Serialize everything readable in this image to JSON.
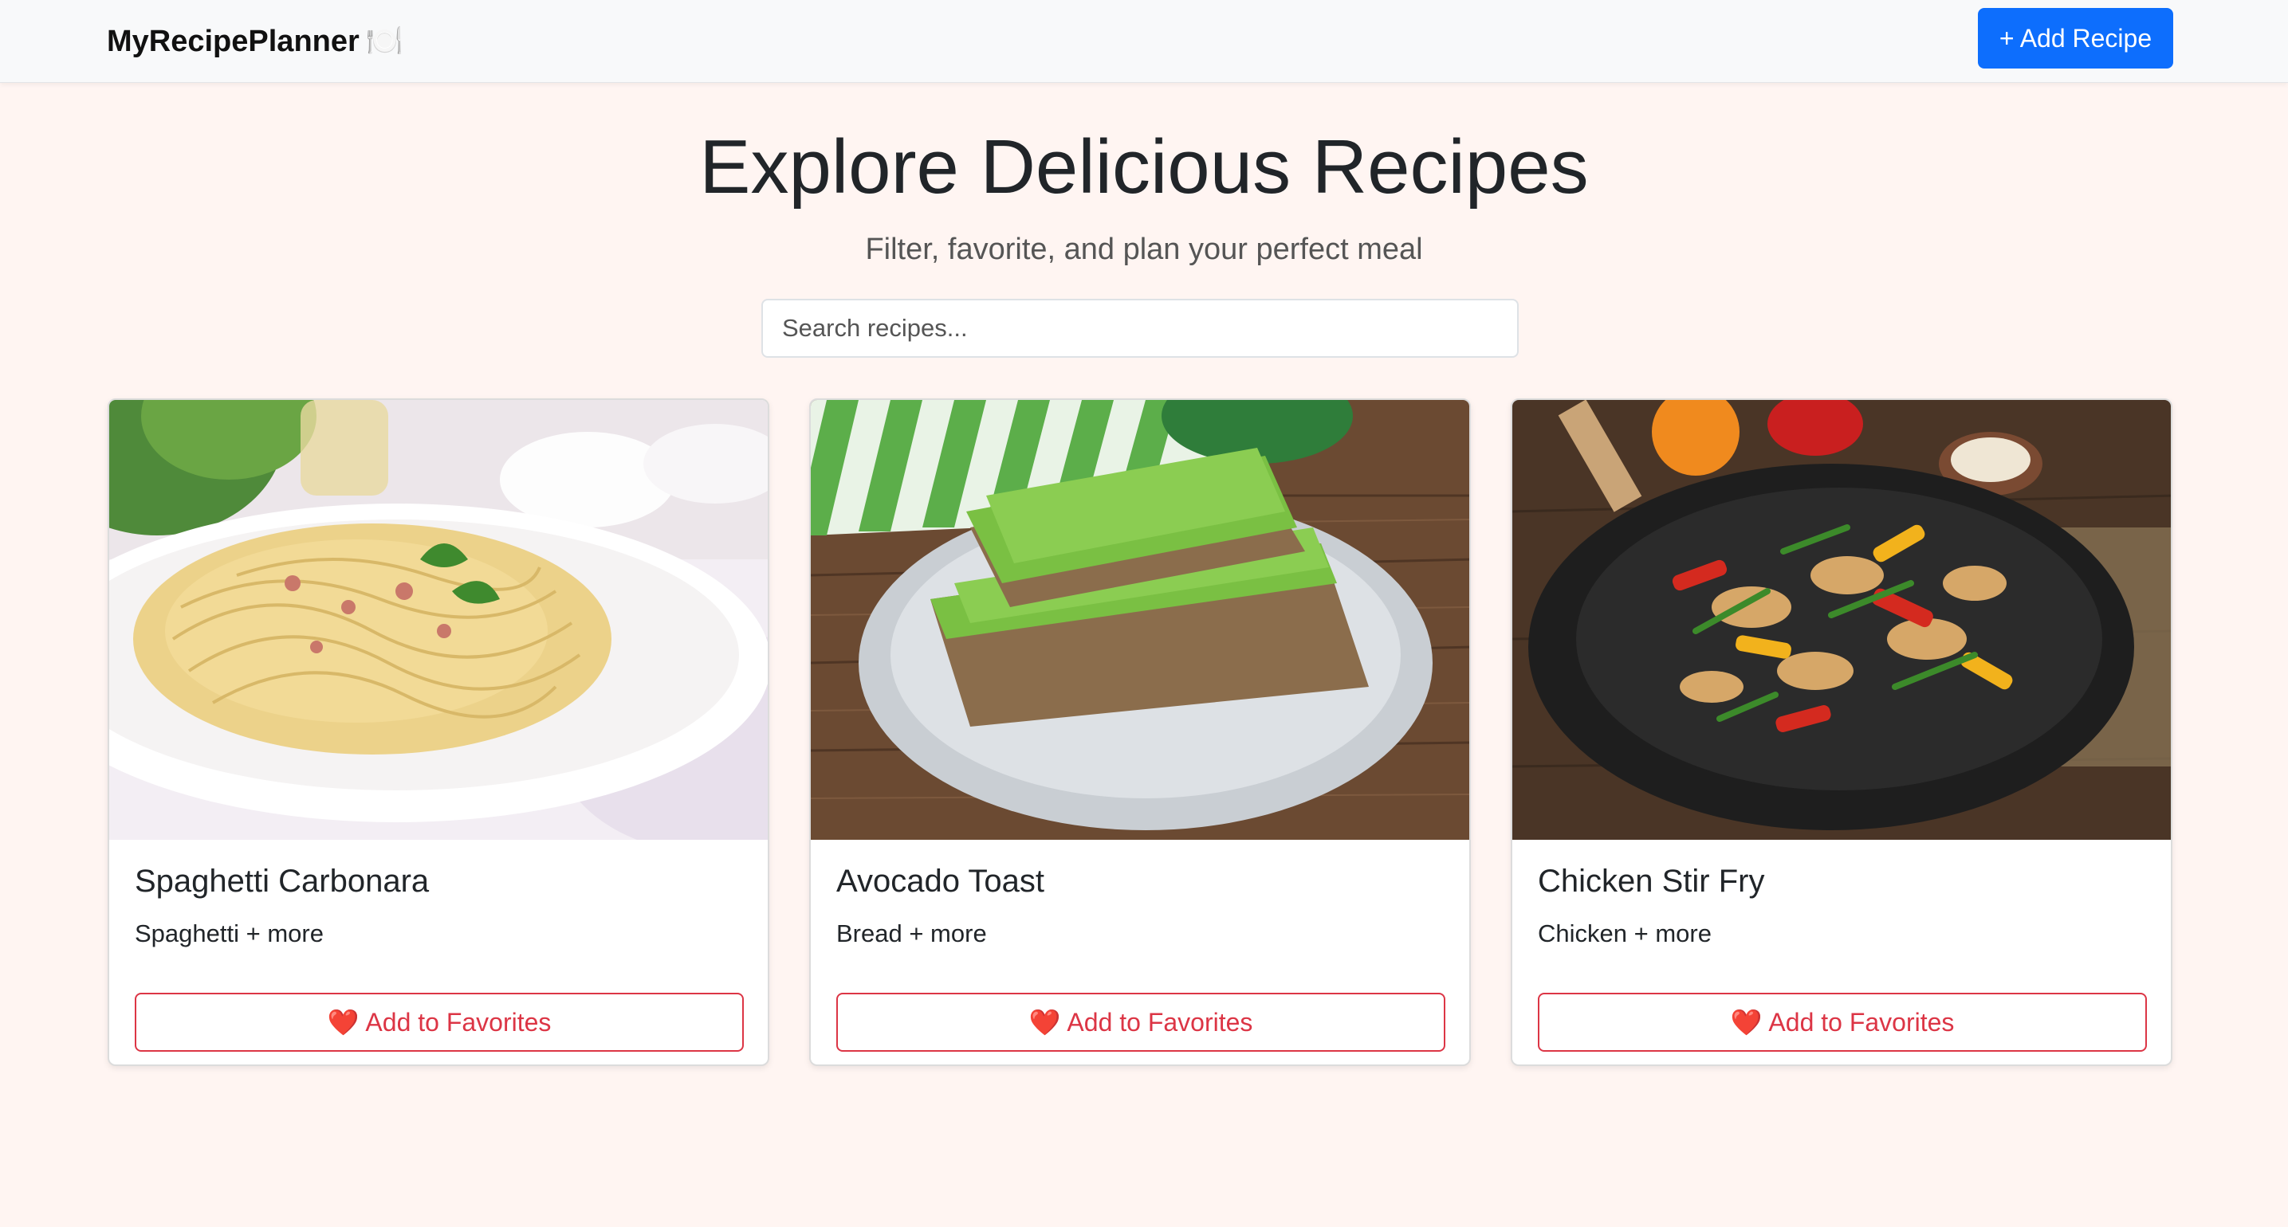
{
  "navbar": {
    "brand": "MyRecipePlanner",
    "brand_icon": "🍽️",
    "add_recipe_label": "+ Add Recipe"
  },
  "hero": {
    "title": "Explore Delicious Recipes",
    "subtitle": "Filter, favorite, and plan your perfect meal"
  },
  "search": {
    "placeholder": "Search recipes..."
  },
  "recipes": [
    {
      "title": "Spaghetti Carbonara",
      "subtitle": "Spaghetti + more",
      "favorite_label": "Add to Favorites",
      "image": "spaghetti-carbonara-photo"
    },
    {
      "title": "Avocado Toast",
      "subtitle": "Bread + more",
      "favorite_label": "Add to Favorites",
      "image": "avocado-toast-photo"
    },
    {
      "title": "Chicken Stir Fry",
      "subtitle": "Chicken + more",
      "favorite_label": "Add to Favorites",
      "image": "chicken-stir-fry-photo"
    }
  ],
  "icons": {
    "heart": "❤️"
  },
  "colors": {
    "primary": "#0d6efd",
    "danger": "#dc3545",
    "background": "#fff5f2"
  }
}
